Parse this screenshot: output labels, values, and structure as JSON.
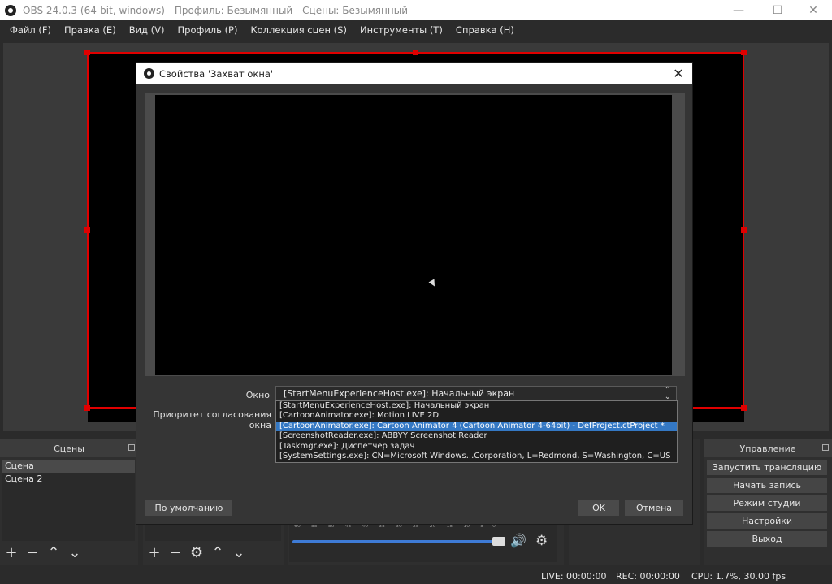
{
  "window": {
    "title": "OBS 24.0.3 (64-bit, windows) - Профиль: Безымянный - Сцены: Безымянный",
    "minimize": "—",
    "maximize": "☐",
    "close": "✕"
  },
  "menu": [
    "Файл (F)",
    "Правка (E)",
    "Вид (V)",
    "Профиль (P)",
    "Коллекция сцен (S)",
    "Инструменты (T)",
    "Справка (H)"
  ],
  "scenes_dock": {
    "title": "Сцены",
    "items": [
      "Сцена",
      "Сцена 2"
    ]
  },
  "controls_dock": {
    "title": "Управление",
    "buttons": [
      "Запустить трансляцию",
      "Начать запись",
      "Режим студии",
      "Настройки",
      "Выход"
    ]
  },
  "mixer": {
    "ticks": [
      "-60",
      "-55",
      "-50",
      "-45",
      "-40",
      "-35",
      "-30",
      "-25",
      "-20",
      "-15",
      "-10",
      "-5",
      "0"
    ]
  },
  "status": {
    "live": "LIVE: 00:00:00",
    "rec": "REC: 00:00:00",
    "cpu": "CPU: 1.7%, 30.00 fps"
  },
  "dialog": {
    "title": "Свойства 'Захват окна'",
    "close": "✕",
    "window_label": "Окно",
    "window_value": "[StartMenuExperienceHost.exe]: Начальный экран",
    "priority_label": "Приоритет согласования окна",
    "options": [
      "[StartMenuExperienceHost.exe]: Начальный экран",
      "[CartoonAnimator.exe]: Motion LIVE 2D",
      "[CartoonAnimator.exe]: Cartoon Animator 4  (Cartoon Animator 4-64bit) - DefProject.ctProject *",
      "[ScreenshotReader.exe]: ABBYY Screenshot Reader",
      "[Taskmgr.exe]: Диспетчер задач",
      "[SystemSettings.exe]: CN=Microsoft Windows...Corporation, L=Redmond, S=Washington, C=US"
    ],
    "selected_index": 2,
    "defaults_button": "По умолчанию",
    "ok_button": "OK",
    "cancel_button": "Отмена"
  },
  "icons": {
    "add": "+",
    "remove": "−",
    "up": "⌃",
    "down": "⌄",
    "gear": "⚙",
    "speaker": "🔊"
  }
}
